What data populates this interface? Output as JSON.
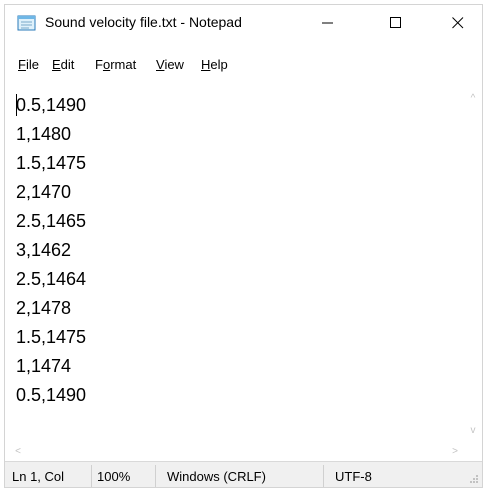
{
  "window": {
    "title": "Sound velocity file.txt - Notepad",
    "controls": {
      "minimize": "—",
      "maximize": "☐",
      "close": "✕"
    }
  },
  "menu": [
    {
      "mnemonic": "F",
      "rest": "ile"
    },
    {
      "mnemonic": "E",
      "rest": "dit"
    },
    {
      "prefix": "F",
      "mnemonic": "o",
      "rest": "rmat"
    },
    {
      "mnemonic": "V",
      "rest": "iew"
    },
    {
      "mnemonic": "H",
      "rest": "elp"
    }
  ],
  "editor": {
    "lines": [
      "0.5,1490",
      "1,1480",
      "1.5,1475",
      "2,1470",
      "2.5,1465",
      "3,1462",
      "2.5,1464",
      "2,1478",
      "1.5,1475",
      "1,1474",
      "0.5,1490"
    ]
  },
  "scrollbars": {
    "up": "^",
    "down": "v",
    "left": "<",
    "right": ">"
  },
  "status": {
    "position": "Ln 1, Col",
    "zoom": "100%",
    "line_ending": "Windows (CRLF)",
    "encoding": "UTF-8"
  },
  "icons": {
    "app": "notepad-icon",
    "resize": "resize-grip-icon"
  },
  "colors": {
    "status_bg": "#f0f0f0",
    "scroll_arrow": "#c3c3c3",
    "watermark": "#f2f2f2"
  }
}
